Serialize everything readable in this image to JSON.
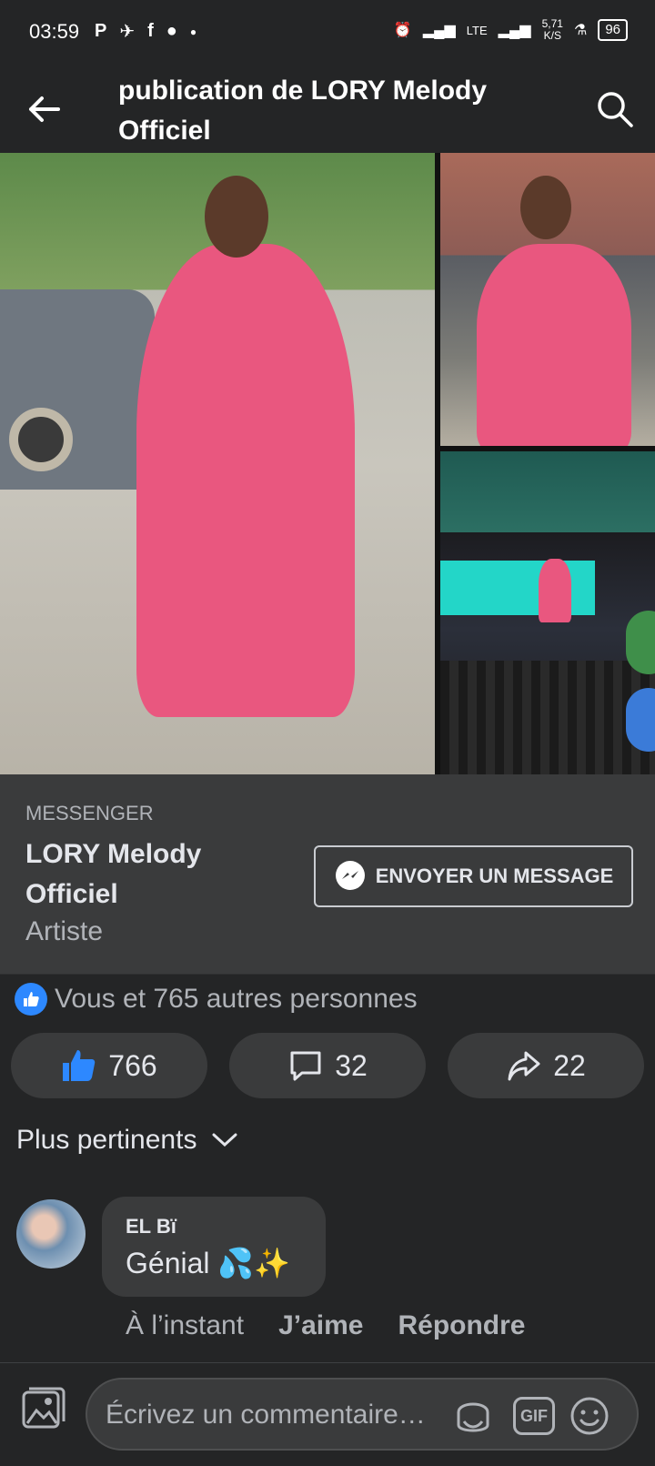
{
  "status_bar": {
    "time": "03:59",
    "network_type": "LTE",
    "speed_value": "5,71",
    "speed_unit": "K/S",
    "battery_level": "96"
  },
  "header": {
    "title": "publication de LORY Melody Officiel"
  },
  "messenger_card": {
    "label": "MESSENGER",
    "page_name": "LORY Melody Officiel",
    "category": "Artiste",
    "send_button_label": "ENVOYER UN MESSAGE"
  },
  "reactions": {
    "summary_text": "Vous et 765 autres personnes",
    "likes_count": "766",
    "comments_count": "32",
    "shares_count": "22"
  },
  "comments": {
    "sort_label": "Plus pertinents",
    "items": [
      {
        "author": "EL Bï",
        "text": "Génial 💦✨",
        "time": "À l’instant",
        "like_label": "J’aime",
        "reply_label": "Répondre"
      }
    ]
  },
  "composer": {
    "placeholder": "Écrivez un commentaire…",
    "gif_label": "GIF"
  },
  "colors": {
    "background": "#242526",
    "card": "#3a3b3c",
    "accent_blue": "#2d88ff",
    "outfit_pink": "#e9577f"
  }
}
